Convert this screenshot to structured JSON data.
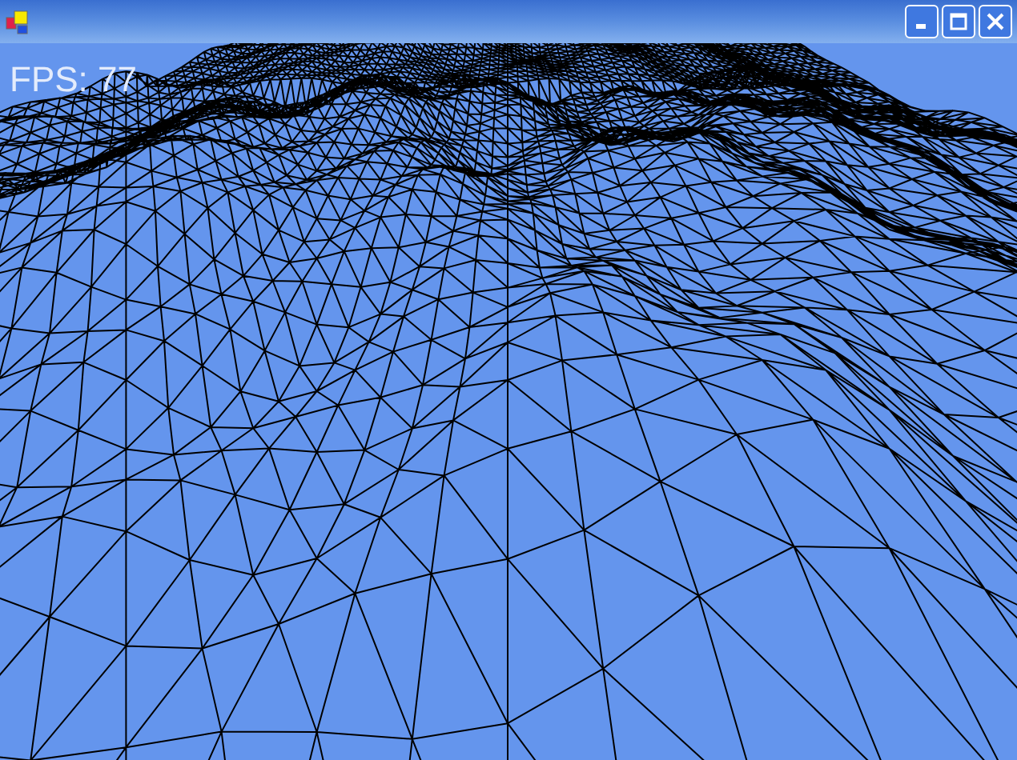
{
  "overlay": {
    "fps_text": "FPS: 77"
  }
}
